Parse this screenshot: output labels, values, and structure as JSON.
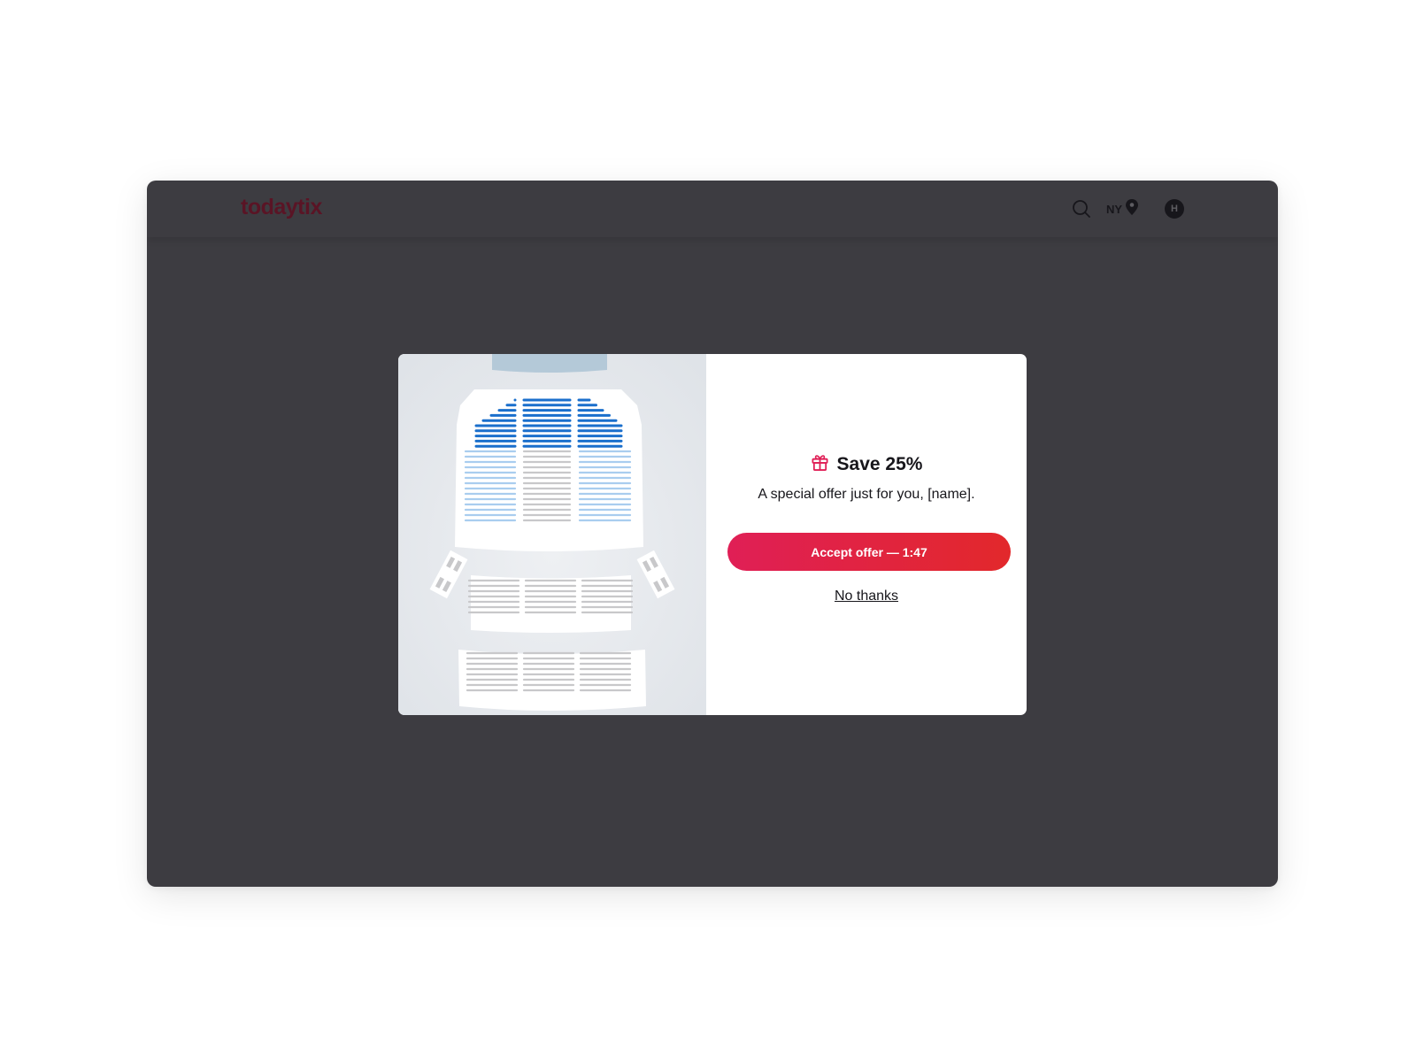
{
  "header": {
    "logo_text": "todaytix",
    "search_icon": "search-icon",
    "city_label": "NY",
    "city_icon": "location-pin-icon",
    "avatar_initial": "H"
  },
  "modal": {
    "offer": {
      "icon": "gift-icon",
      "title": "Save 25%",
      "subtitle": "A special offer just for you, [name].",
      "accept_label": "Accept offer — 1:47",
      "decline_label": "No thanks"
    },
    "seat_map": {
      "highlighted_section": "front orchestra center",
      "colors": {
        "available_dark": "#1a6fcc",
        "available_light": "#a9cdef",
        "unavailable": "#c8c8ca",
        "stage": "#b4c9d8",
        "background": "#e3e6ea"
      }
    }
  },
  "colors": {
    "brand": "#5a1425",
    "accent": "#e01f56",
    "overlay": "#3d3c41"
  }
}
